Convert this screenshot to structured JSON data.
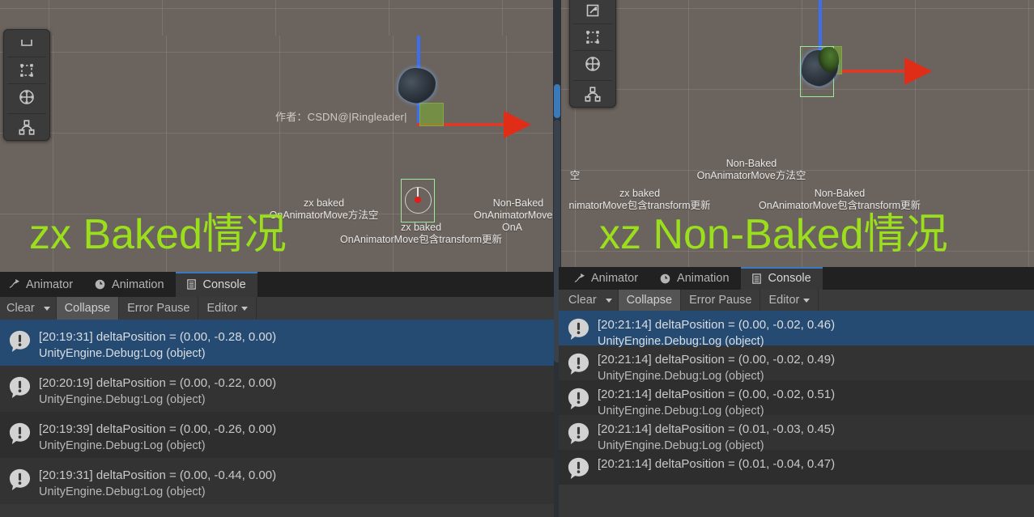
{
  "app": "Unity Editor",
  "scene_left": {
    "watermark": "作者：CSDN@|Ringleader|",
    "headline": "zx Baked情况",
    "labels": [
      {
        "line1": "zx baked",
        "line2": "OnAnimatorMove方法空"
      },
      {
        "line1": "Non-Baked",
        "line2": "OnAnimatorMove方"
      },
      {
        "line1": "zx baked",
        "line2": "OnAnimatorMove包含transform更新"
      },
      {
        "line1": "",
        "line2": "OnA"
      }
    ]
  },
  "scene_right": {
    "headline": "xz Non-Baked情况",
    "labels": [
      {
        "line1": "",
        "line2": "空"
      },
      {
        "line1": "Non-Baked",
        "line2": "OnAnimatorMove方法空"
      },
      {
        "line1": "zx baked",
        "line2": "nimatorMove包含transform更新"
      },
      {
        "line1": "Non-Baked",
        "line2": "OnAnimatorMove包含transform更新"
      }
    ]
  },
  "tools": {
    "left": [
      {
        "name": "rect-tool-partial",
        "icon": "rect-partial-icon"
      },
      {
        "name": "rect-tool",
        "icon": "rect-transform-icon"
      },
      {
        "name": "transform-tool",
        "icon": "transform-move-icon"
      },
      {
        "name": "custom-tool",
        "icon": "custom-editor-tool-icon"
      }
    ],
    "right": [
      {
        "name": "rotate-tool",
        "icon": "rotate-icon"
      },
      {
        "name": "scale-tool",
        "icon": "scale-icon"
      },
      {
        "name": "rect-tool",
        "icon": "rect-transform-icon"
      },
      {
        "name": "transform-tool",
        "icon": "transform-move-icon"
      },
      {
        "name": "custom-tool",
        "icon": "custom-editor-tool-icon"
      }
    ]
  },
  "left_panel": {
    "tabs": [
      {
        "label": "Animator",
        "icon": "animator-icon",
        "active": false
      },
      {
        "label": "Animation",
        "icon": "animation-clock-icon",
        "active": false
      },
      {
        "label": "Console",
        "icon": "console-icon",
        "active": true
      }
    ],
    "toolbar": {
      "clear": "Clear",
      "clear_dropdown": "clear-dropdown-caret",
      "collapse": "Collapse",
      "error_pause": "Error Pause",
      "editor": "Editor",
      "editor_dropdown": "editor-dropdown-caret"
    },
    "logs": [
      {
        "message": "[20:19:31] deltaPosition = (0.00, -0.28, 0.00)",
        "stack": "UnityEngine.Debug:Log (object)",
        "selected": true
      },
      {
        "message": "[20:20:19] deltaPosition = (0.00, -0.22, 0.00)",
        "stack": "UnityEngine.Debug:Log (object)",
        "selected": false
      },
      {
        "message": "[20:19:39] deltaPosition = (0.00, -0.26, 0.00)",
        "stack": "UnityEngine.Debug:Log (object)",
        "selected": false
      },
      {
        "message": "[20:19:31] deltaPosition = (0.00, -0.44, 0.00)",
        "stack": "UnityEngine.Debug:Log (object)",
        "selected": false
      }
    ]
  },
  "right_panel": {
    "tabs": [
      {
        "label": "Animator",
        "icon": "animator-icon",
        "active": false
      },
      {
        "label": "Animation",
        "icon": "animation-clock-icon",
        "active": false
      },
      {
        "label": "Console",
        "icon": "console-icon",
        "active": true
      }
    ],
    "toolbar": {
      "clear": "Clear",
      "clear_dropdown": "clear-dropdown-caret",
      "collapse": "Collapse",
      "error_pause": "Error Pause",
      "editor": "Editor",
      "editor_dropdown": "editor-dropdown-caret"
    },
    "logs": [
      {
        "message": "[20:21:14] deltaPosition = (0.00, -0.02, 0.46)",
        "stack": "UnityEngine.Debug:Log (object)",
        "selected": true
      },
      {
        "message": "[20:21:14] deltaPosition = (0.00, -0.02, 0.49)",
        "stack": "UnityEngine.Debug:Log (object)",
        "selected": false
      },
      {
        "message": "[20:21:14] deltaPosition = (0.00, -0.02, 0.51)",
        "stack": "UnityEngine.Debug:Log (object)",
        "selected": false
      },
      {
        "message": "[20:21:14] deltaPosition = (0.01, -0.03, 0.45)",
        "stack": "UnityEngine.Debug:Log (object)",
        "selected": false
      },
      {
        "message": "[20:21:14] deltaPosition = (0.01, -0.04, 0.47)",
        "stack": "",
        "selected": false
      }
    ]
  },
  "colors": {
    "scene_bg": "#6b635d",
    "panel_bg": "#383838",
    "tabbar_bg": "#212121",
    "selection": "#254b72",
    "accent_green": "#9ade1c",
    "axis_x": "#e02d18",
    "axis_y": "#3b6ef0",
    "gizmo_green": "#9ee89a"
  }
}
